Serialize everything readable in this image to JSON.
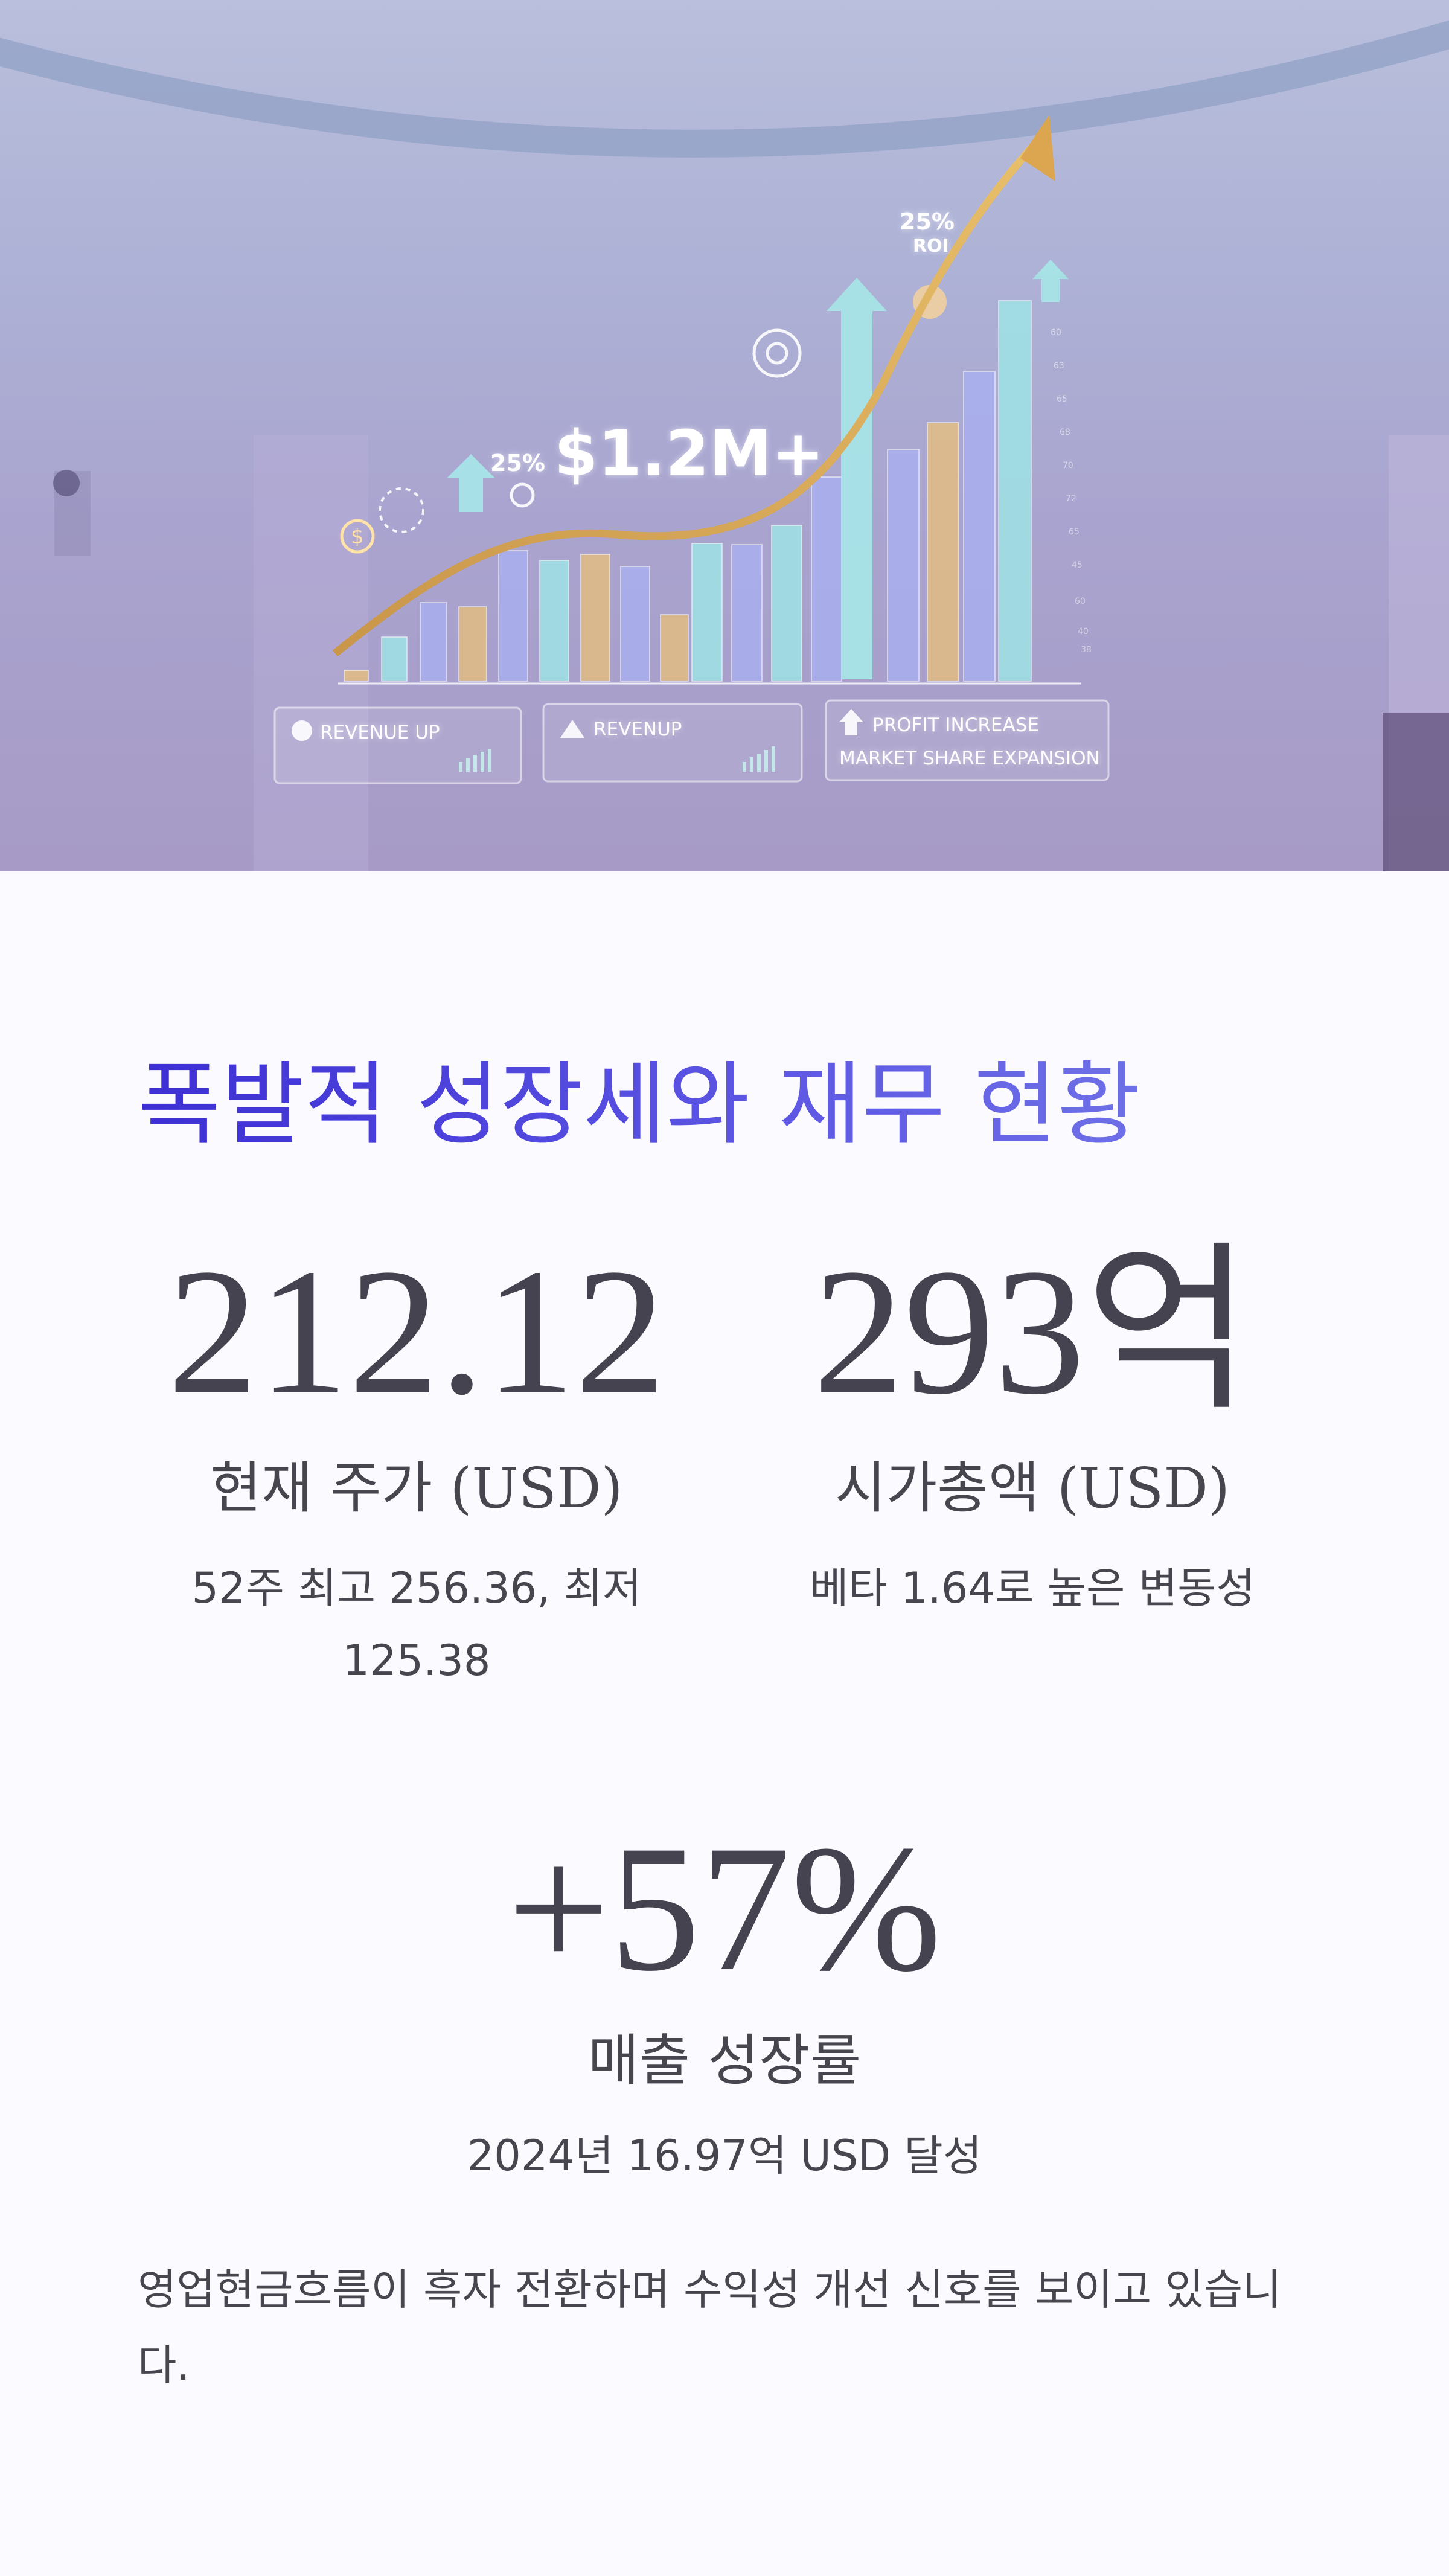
{
  "hero": {
    "headline": "$1.2M+",
    "small_pct": "25%",
    "roi_pct": "25%",
    "roi_label": "ROI",
    "panels": [
      {
        "label": "REVENUE UP"
      },
      {
        "label": "REVENUP"
      },
      {
        "label": "PROFIT INCREASE",
        "label2": "MARKET SHARE EXPANSION"
      }
    ],
    "colors": {
      "teal_bar": "#9fe3e6",
      "lavender_bar": "#a9b0ef",
      "gold_bar": "#e3bd84",
      "arrow": "#d9a849"
    }
  },
  "section": {
    "title": "폭발적 성장세와 재무 현황"
  },
  "stats": [
    {
      "value": "212.12",
      "label": "현재 주가 (USD)",
      "sub": "52주 최고 256.36, 최저 125.38"
    },
    {
      "value": "293억",
      "label": "시가총액 (USD)",
      "sub": "베타 1.64로 높은 변동성"
    },
    {
      "value": "+57%",
      "label": "매출 성장률",
      "sub": "2024년 16.97억 USD 달성"
    }
  ],
  "summary": "영업현금흐름이 흑자 전환하며 수익성 개선 신호를 보이고 있습니다.",
  "theme": {
    "title_gradient_start": "#3d2fd3",
    "title_gradient_end": "#6e70e7",
    "text": "#44434f",
    "background": "#fbfaff"
  }
}
